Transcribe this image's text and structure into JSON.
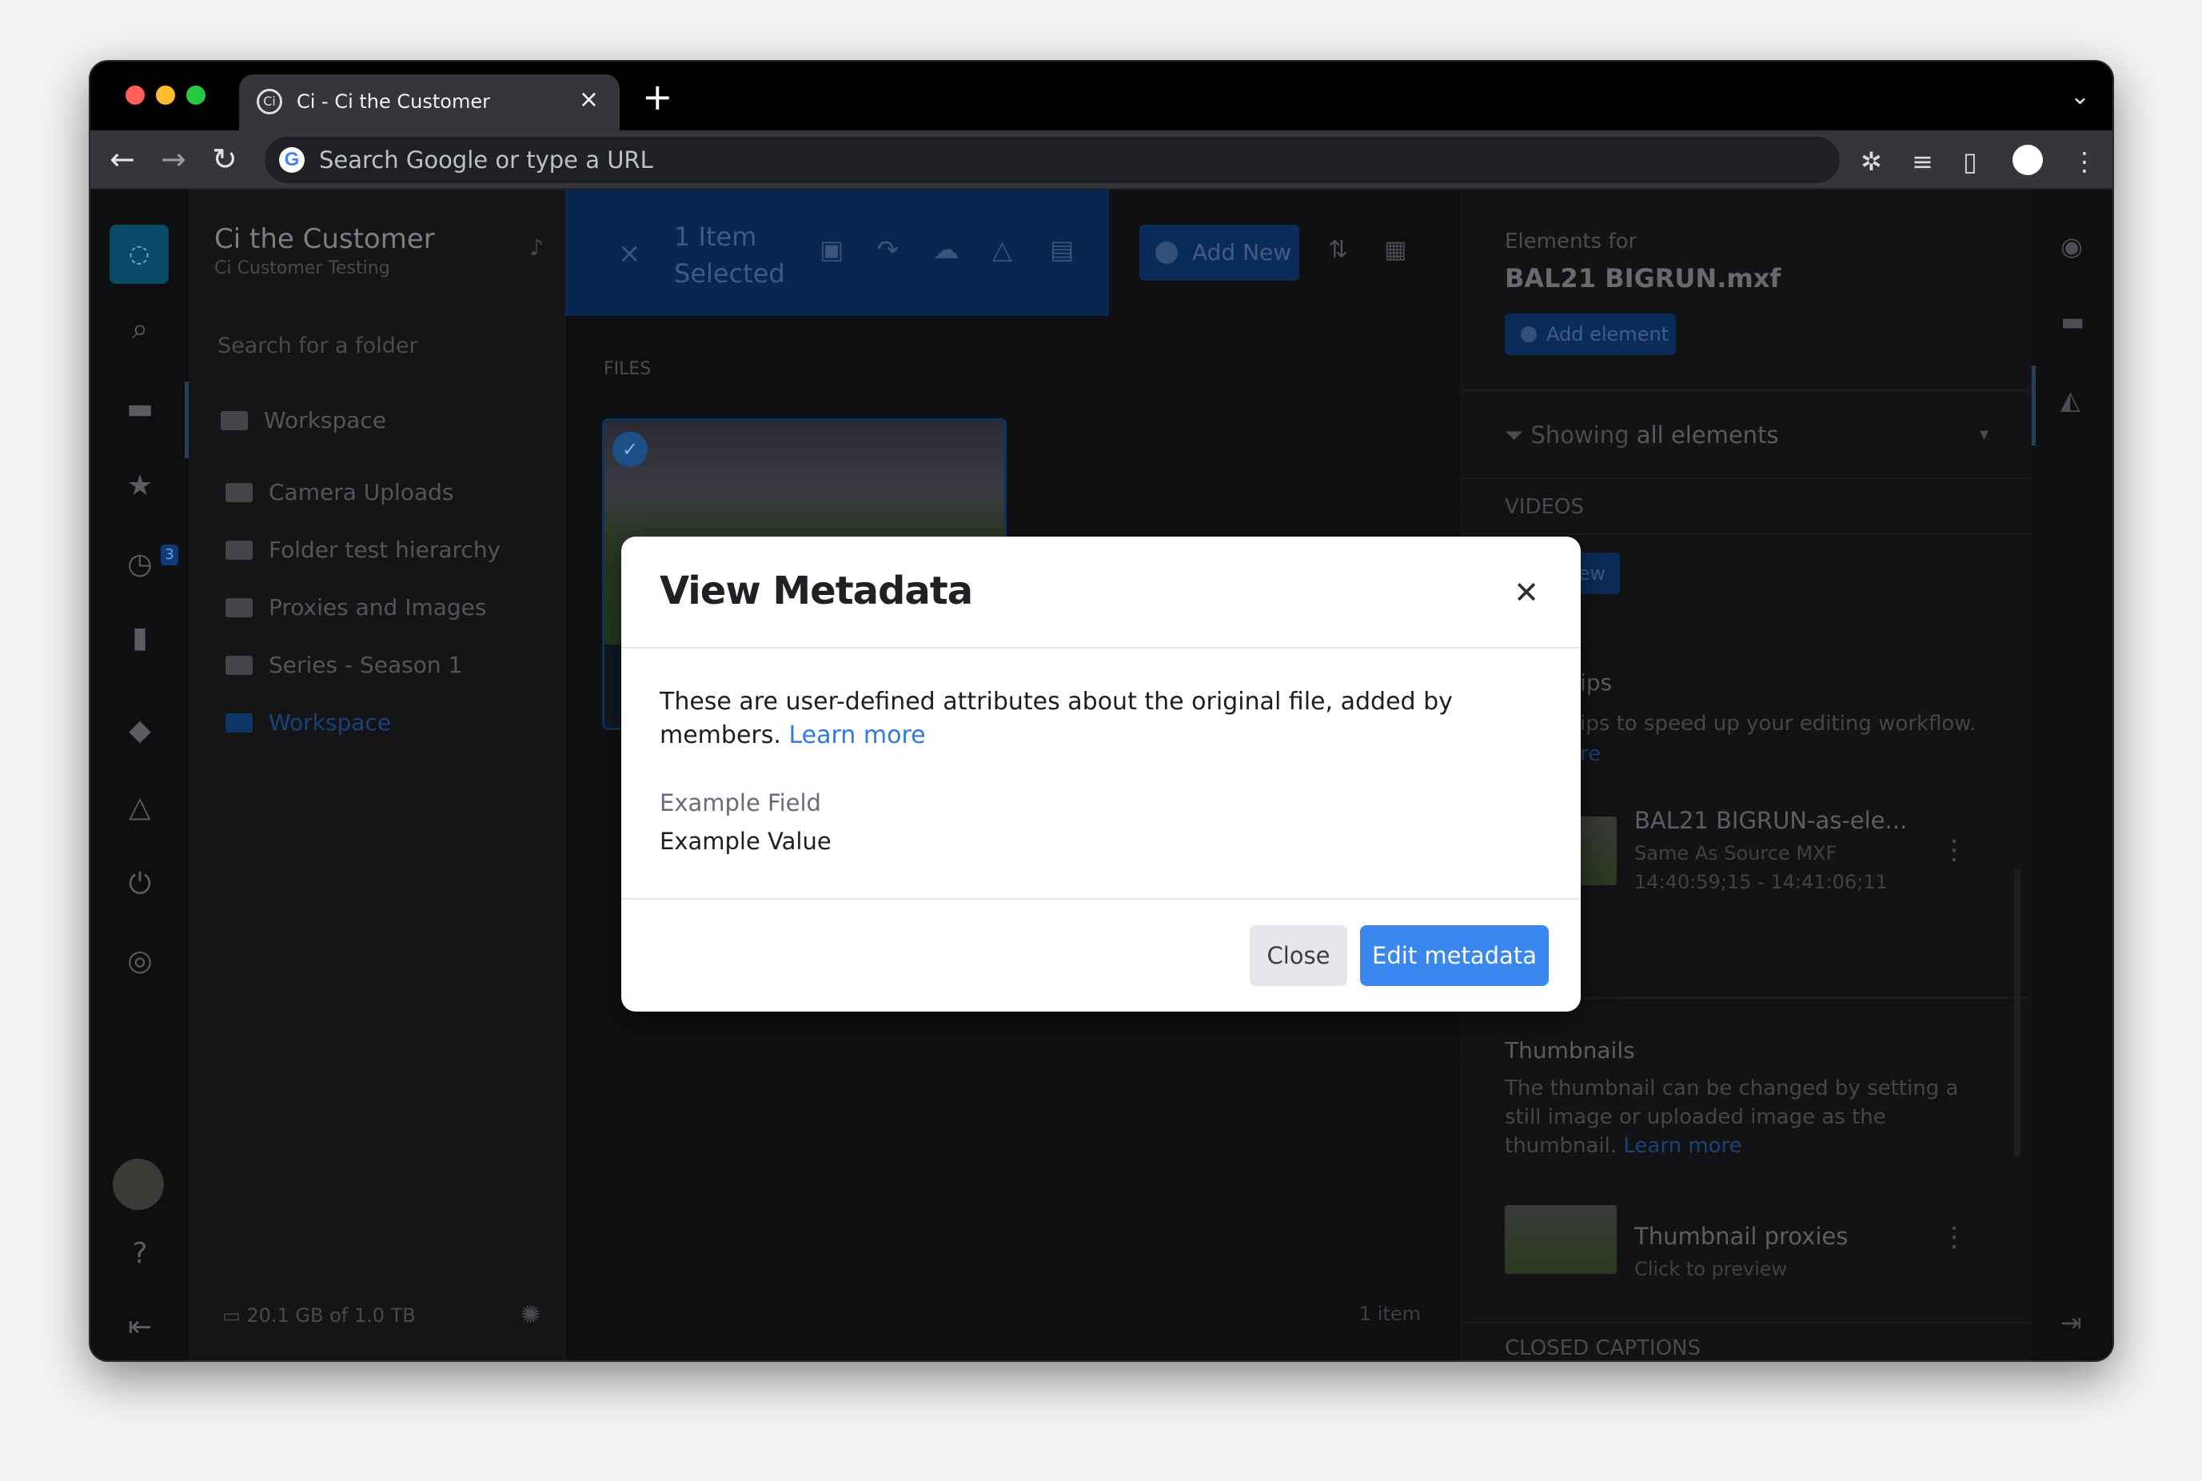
{
  "browser": {
    "tab_title": "Ci - Ci the Customer",
    "tab_close": "×",
    "new_tab": "+",
    "address_placeholder": "Search Google or type a URL"
  },
  "sidebar": {
    "workspace_name": "Ci the Customer",
    "workspace_sub": "Ci Customer Testing",
    "recent_badge": "3",
    "folder_search_placeholder": "Search for a folder",
    "folders": [
      {
        "label": "Workspace"
      },
      {
        "label": "Camera Uploads"
      },
      {
        "label": "Folder test hierarchy"
      },
      {
        "label": "Proxies and Images"
      },
      {
        "label": "Series - Season 1"
      },
      {
        "label": "Workspace"
      }
    ],
    "storage": "20.1 GB of 1.0 TB"
  },
  "toolbar": {
    "selection_count": "1 Item Selected",
    "add_new": "Add New"
  },
  "files": {
    "section_label": "FILES",
    "item_count": "1 item"
  },
  "elements_panel": {
    "heading": "Elements for",
    "file_name": "BAL21 BIGRUN.mxf",
    "add_element": "Add element",
    "filter_prefix": "Showing",
    "filter_value": "all elements",
    "videos_label": "VIDEOS",
    "new_btn_partial": "e new",
    "clips_title_partial": "ips",
    "clips_desc_partial": "ips to speed up your editing workflow.",
    "clips_link_partial": "re",
    "clip": {
      "title": "BAL21 BIGRUN-as-ele...",
      "subtitle": "Same As Source MXF",
      "timecode": "14:40:59;15 - 14:41:06;11"
    },
    "thumbnails_title": "Thumbnails",
    "thumbnails_desc": "The thumbnail can be changed by setting a still image or uploaded image as the thumbnail.",
    "thumbnails_link_a": "Learn",
    "thumbnails_link_b": "more",
    "thumb_item": {
      "title": "Thumbnail proxies",
      "subtitle": "Click to preview"
    },
    "captions_label": "CLOSED CAPTIONS"
  },
  "modal": {
    "title": "View Metadata",
    "description": "These are user-defined attributes about the original file, added by members.",
    "learn_more_a": "Learn",
    "learn_more_b": "more",
    "field_label": "Example Field",
    "field_value": "Example Value",
    "close_button": "Close",
    "edit_button": "Edit metadata"
  }
}
